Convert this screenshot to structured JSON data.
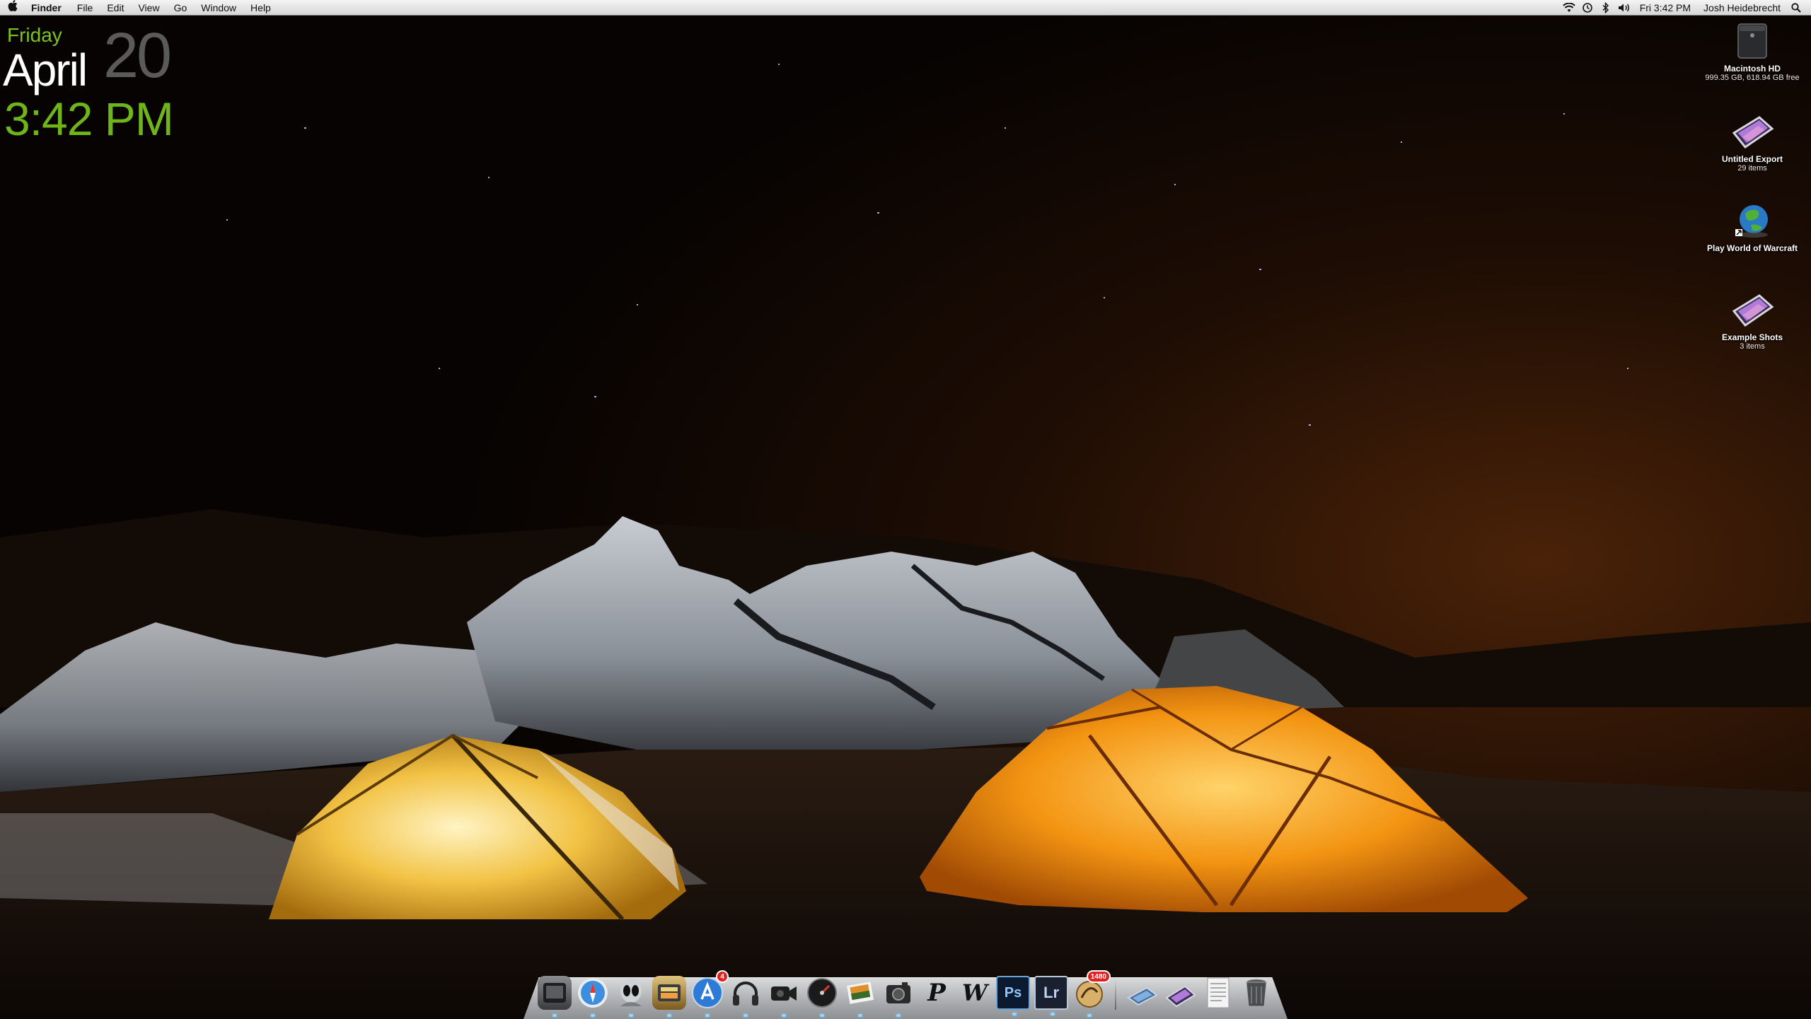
{
  "menubar": {
    "apple_icon": "apple-logo-icon",
    "app_name": "Finder",
    "menus": [
      "File",
      "Edit",
      "View",
      "Go",
      "Window",
      "Help"
    ],
    "status_icons": [
      "wifi-icon",
      "time-machine-icon",
      "bluetooth-icon",
      "volume-icon"
    ],
    "clock": "Fri 3:42 PM",
    "user": "Josh Heidebrecht",
    "spotlight_icon": "spotlight-search-icon"
  },
  "clock_widget": {
    "day": "Friday",
    "month": "April",
    "date": "20",
    "time": "3:42 PM",
    "accent_color": "#7dc31b"
  },
  "desktop_icons": [
    {
      "name": "Macintosh HD",
      "sub": "999.35 GB, 618.94 GB free",
      "icon": "hard-drive-icon"
    },
    {
      "name": "Untitled Export",
      "sub": "29 items",
      "icon": "photo-folder-icon"
    },
    {
      "name": "Play World of Warcraft",
      "sub": "",
      "icon": "world-of-warcraft-globe-icon"
    },
    {
      "name": "Example Shots",
      "sub": "3 items",
      "icon": "photo-folder-icon"
    }
  ],
  "dock": {
    "apps": [
      {
        "id": "finder",
        "label": "",
        "icon": "finder-icon"
      },
      {
        "id": "safari",
        "label": "",
        "icon": "safari-compass-icon"
      },
      {
        "id": "alien",
        "label": "",
        "icon": "alien-app-icon"
      },
      {
        "id": "tweetie",
        "label": "",
        "icon": "bird-app-icon"
      },
      {
        "id": "app-store",
        "label": "",
        "icon": "app-store-icon",
        "badge": "4"
      },
      {
        "id": "headphones",
        "label": "",
        "icon": "headphones-icon"
      },
      {
        "id": "facetime",
        "label": "",
        "icon": "camera-icon"
      },
      {
        "id": "dashboard",
        "label": "",
        "icon": "gauge-icon"
      },
      {
        "id": "iphoto",
        "label": "",
        "icon": "photos-icon"
      },
      {
        "id": "camera",
        "label": "",
        "icon": "camera-box-icon"
      },
      {
        "id": "pages",
        "label": "P",
        "icon": "script-p-icon"
      },
      {
        "id": "wacom",
        "label": "W",
        "icon": "script-w-icon"
      },
      {
        "id": "photoshop",
        "label": "Ps",
        "icon": "photoshop-icon"
      },
      {
        "id": "lightroom",
        "label": "Lr",
        "icon": "lightroom-icon"
      },
      {
        "id": "mail",
        "label": "",
        "icon": "mail-stamp-icon",
        "badge": "1480"
      }
    ],
    "stacks": [
      {
        "id": "downloads",
        "icon": "downloads-stack-icon"
      },
      {
        "id": "photos-stack",
        "icon": "photo-stack-icon"
      },
      {
        "id": "documents",
        "icon": "documents-stack-icon"
      },
      {
        "id": "trash",
        "icon": "trash-icon"
      }
    ]
  }
}
